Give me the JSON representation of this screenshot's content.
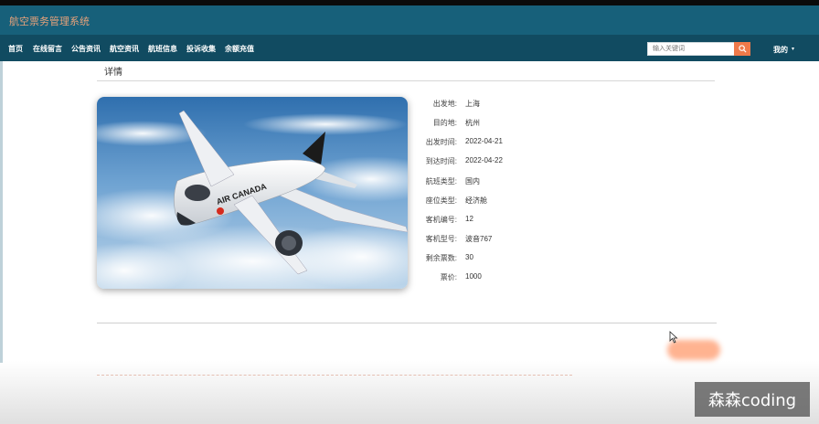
{
  "app": {
    "title": "航空票务管理系统"
  },
  "nav": {
    "items": [
      {
        "label": "首页"
      },
      {
        "label": "在线留言"
      },
      {
        "label": "公告资讯"
      },
      {
        "label": "航空资讯"
      },
      {
        "label": "航班信息"
      },
      {
        "label": "投诉收集"
      },
      {
        "label": "余额充值"
      }
    ],
    "search_placeholder": "输入关键词",
    "search_icon": "search-icon",
    "user_menu": "我的"
  },
  "detail": {
    "section_title": "详情",
    "image_icon": "airplane-photo",
    "fields": [
      {
        "label": "出发地:",
        "value": "上海"
      },
      {
        "label": "目的地:",
        "value": "杭州"
      },
      {
        "label": "出发时间:",
        "value": "2022-04-21"
      },
      {
        "label": "到达时间:",
        "value": "2022-04-22"
      },
      {
        "label": "航班类型:",
        "value": "国内"
      },
      {
        "label": "座位类型:",
        "value": "经济舱"
      },
      {
        "label": "客机编号:",
        "value": "12"
      },
      {
        "label": "客机型号:",
        "value": "波音767"
      },
      {
        "label": "剩余票数:",
        "value": "30"
      },
      {
        "label": "票价:",
        "value": "1000"
      }
    ],
    "airline_text": "AIR CANADA"
  },
  "watermark": "森森coding",
  "colors": {
    "titlebar": "#17607a",
    "navbar": "#114b61",
    "title_text": "#e8a27a",
    "search_button": "#f07a4a"
  }
}
